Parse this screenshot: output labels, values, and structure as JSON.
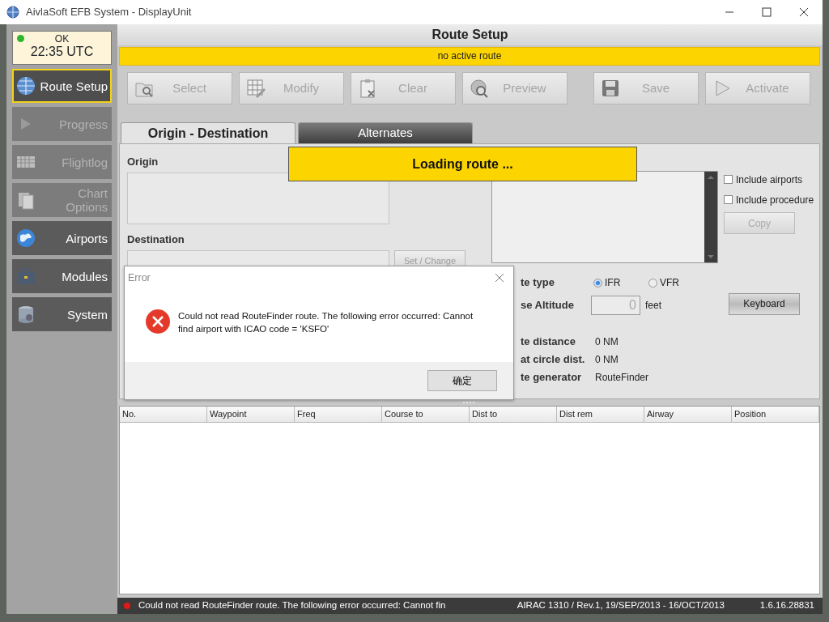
{
  "window": {
    "title": "AivlaSoft EFB System - DisplayUnit"
  },
  "status_box": {
    "status": "OK",
    "time": "22:35 UTC",
    "ok": true
  },
  "sidebar": {
    "items": [
      {
        "label": "Route Setup",
        "selected": true,
        "disabled": false
      },
      {
        "label": "Progress",
        "selected": false,
        "disabled": true
      },
      {
        "label": "Flightlog",
        "selected": false,
        "disabled": true
      },
      {
        "label": "Chart Options",
        "selected": false,
        "disabled": true
      },
      {
        "label": "Airports",
        "selected": false,
        "disabled": false
      },
      {
        "label": "Modules",
        "selected": false,
        "disabled": false
      },
      {
        "label": "System",
        "selected": false,
        "disabled": false
      }
    ]
  },
  "page_title": "Route Setup",
  "route_status": "no active route",
  "toolbar": [
    {
      "label": "Select",
      "disabled": true
    },
    {
      "label": "Modify",
      "disabled": true
    },
    {
      "label": "Clear",
      "disabled": true
    },
    {
      "label": "Preview",
      "disabled": true
    },
    {
      "label": "Save",
      "disabled": true
    },
    {
      "label": "Activate",
      "disabled": true
    }
  ],
  "tabs": [
    {
      "label": "Origin - Destination",
      "selected": true
    },
    {
      "label": "Alternates",
      "selected": false
    }
  ],
  "origin": {
    "label": "Origin"
  },
  "destination": {
    "label": "Destination",
    "button": "Set / Change"
  },
  "options": [
    {
      "label": "Include airports",
      "checked": false
    },
    {
      "label": "Include procedure",
      "checked": false
    }
  ],
  "copy_button": {
    "label": "Copy",
    "disabled": true
  },
  "route_type": {
    "label": "te type",
    "options": [
      {
        "label": "IFR",
        "selected": true
      },
      {
        "label": "VFR",
        "selected": false
      }
    ]
  },
  "altitude": {
    "label": "se Altitude",
    "value": "0",
    "disabled": true,
    "unit": "feet"
  },
  "keyboard_button": "Keyboard",
  "info": [
    {
      "label": "te distance",
      "value": "0 NM"
    },
    {
      "label": "at circle dist.",
      "value": "0 NM"
    },
    {
      "label": "te generator",
      "value": "RouteFinder"
    }
  ],
  "table": {
    "columns": [
      "No.",
      "Waypoint",
      "Freq",
      "Course to",
      "Dist to",
      "Dist rem",
      "Airway",
      "Position"
    ]
  },
  "loading": {
    "text": "Loading route ..."
  },
  "error_dialog": {
    "title": "Error",
    "message": "Could not read RouteFinder route. The following error occurred: Cannot find airport with ICAO code = 'KSFO'",
    "button": "确定"
  },
  "status_bar": {
    "error": true,
    "message": "Could not read RouteFinder route. The following error occurred: Cannot fin",
    "airac": "AIRAC 1310 / Rev.1, 19/SEP/2013 - 16/OCT/2013",
    "version": "1.6.16.28831"
  }
}
